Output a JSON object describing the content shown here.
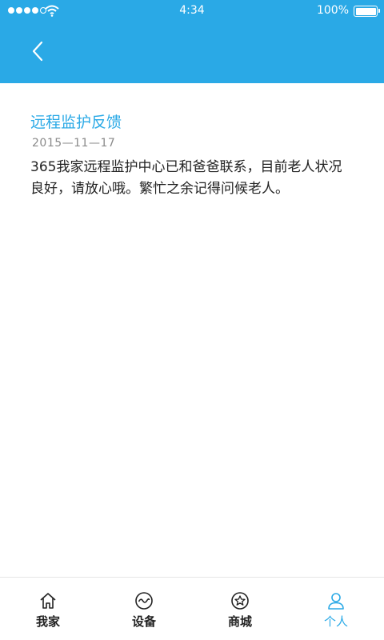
{
  "status_bar": {
    "time": "4:34",
    "battery_percent": "100%",
    "battery_level": 1.0,
    "signal_bars_filled": 4,
    "signal_bars_total": 5
  },
  "header": {
    "back_icon": "chevron-left-icon",
    "background_color": "#2aa9e6"
  },
  "article": {
    "title": "远程监护反馈",
    "date": "2015—11—17",
    "body": "365我家远程监护中心已和爸爸联系，目前老人状况良好，请放心哦。繁忙之余记得问候老人。"
  },
  "tab_bar": {
    "accent_color": "#2aa9e6",
    "tabs": [
      {
        "label": "我家",
        "icon": "home-icon",
        "active": false
      },
      {
        "label": "设备",
        "icon": "device-wave-icon",
        "active": false
      },
      {
        "label": "商城",
        "icon": "star-circle-icon",
        "active": false
      },
      {
        "label": "个人",
        "icon": "person-icon",
        "active": true
      }
    ]
  }
}
